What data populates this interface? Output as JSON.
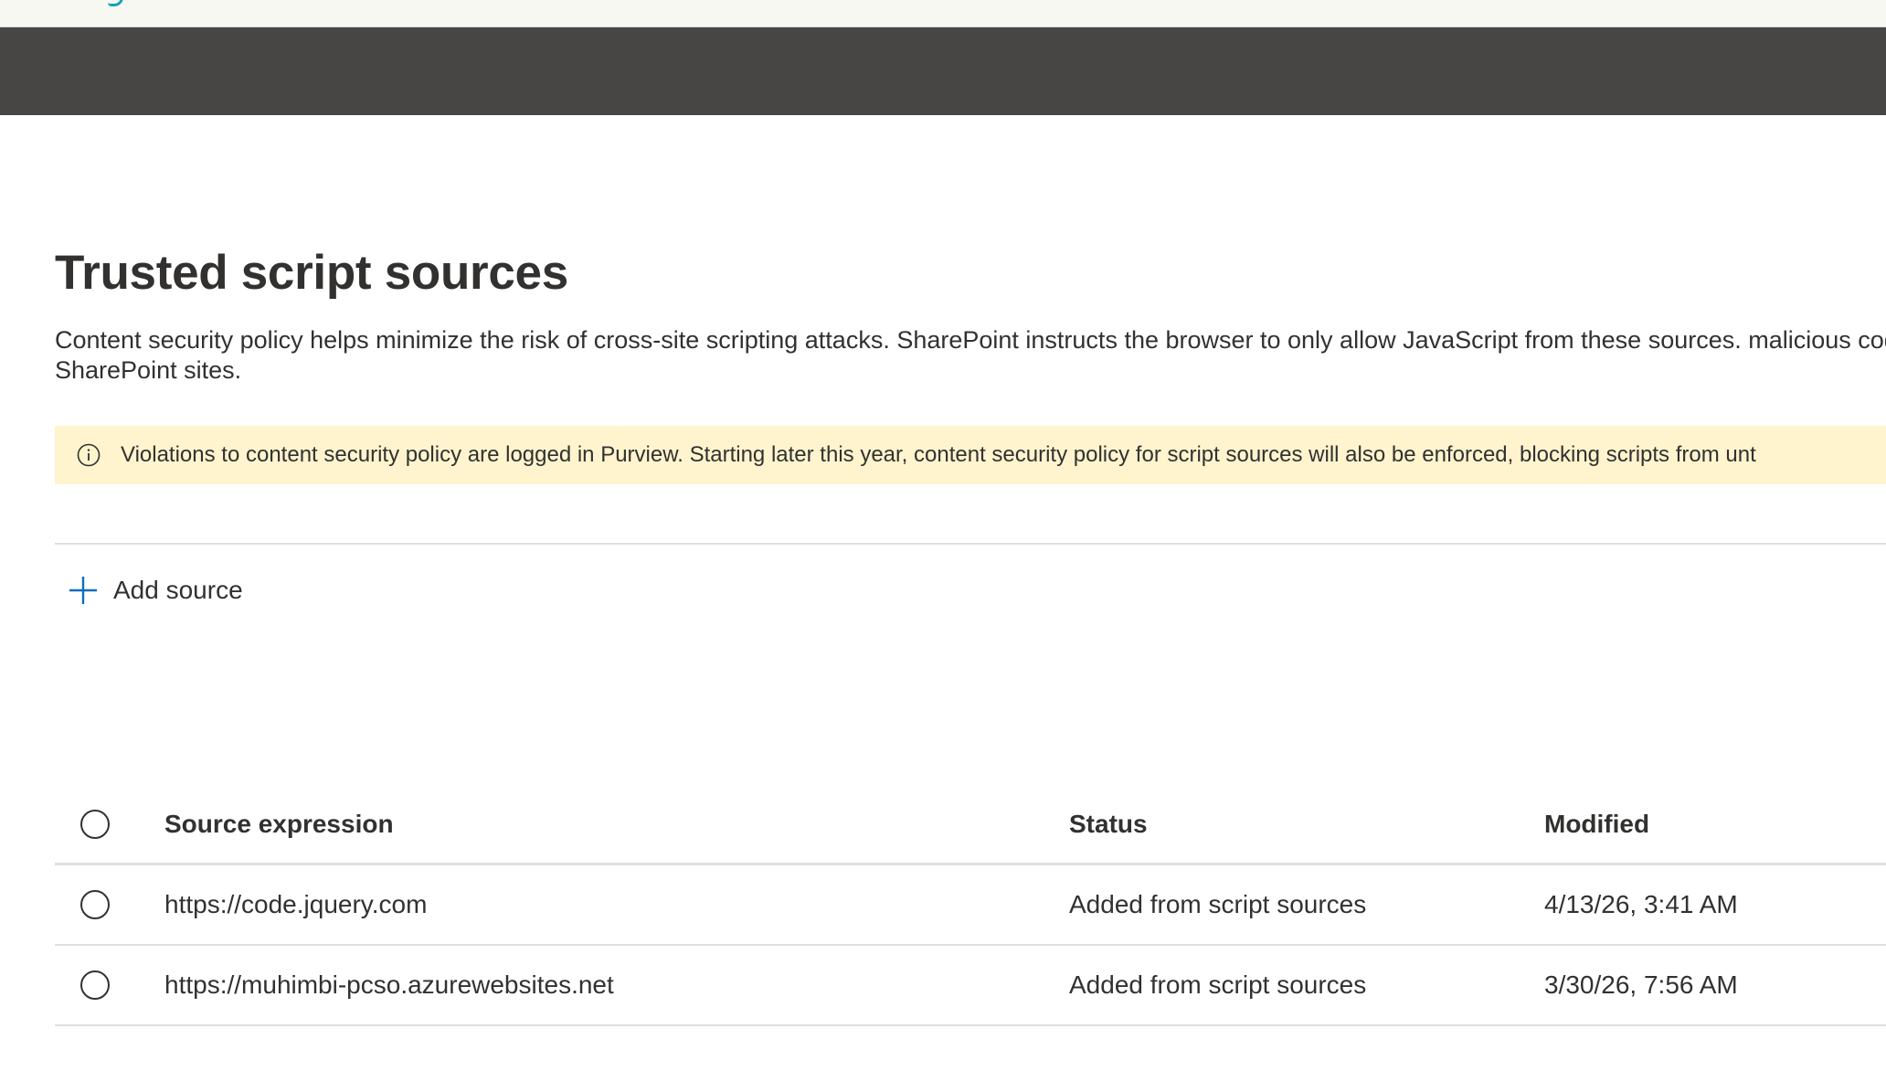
{
  "page": {
    "title": "Trusted script sources",
    "description": "Content security policy helps minimize the risk of cross-site scripting attacks. SharePoint instructs the browser to only allow JavaScript from these sources. malicious code into SharePoint sites."
  },
  "banner": {
    "icon": "info-icon",
    "text": "Violations to content security policy are logged in Purview. Starting later this year, content security policy for script sources will also be enforced, blocking scripts from unt"
  },
  "toolbar": {
    "add_source_icon": "plus-icon",
    "add_source_label": "Add source"
  },
  "table": {
    "columns": {
      "source_expression": "Source expression",
      "status": "Status",
      "modified": "Modified"
    },
    "rows": [
      {
        "source_expression": "https://code.jquery.com",
        "status": "Added from script sources",
        "modified": "4/13/26, 3:41 AM"
      },
      {
        "source_expression": "https://muhimbi-pcso.azurewebsites.net",
        "status": "Added from script sources",
        "modified": "3/30/26, 7:56 AM"
      }
    ]
  },
  "colors": {
    "header_bar": "#484644",
    "banner_bg": "#fff4ce",
    "accent": "#0f6cbd"
  }
}
